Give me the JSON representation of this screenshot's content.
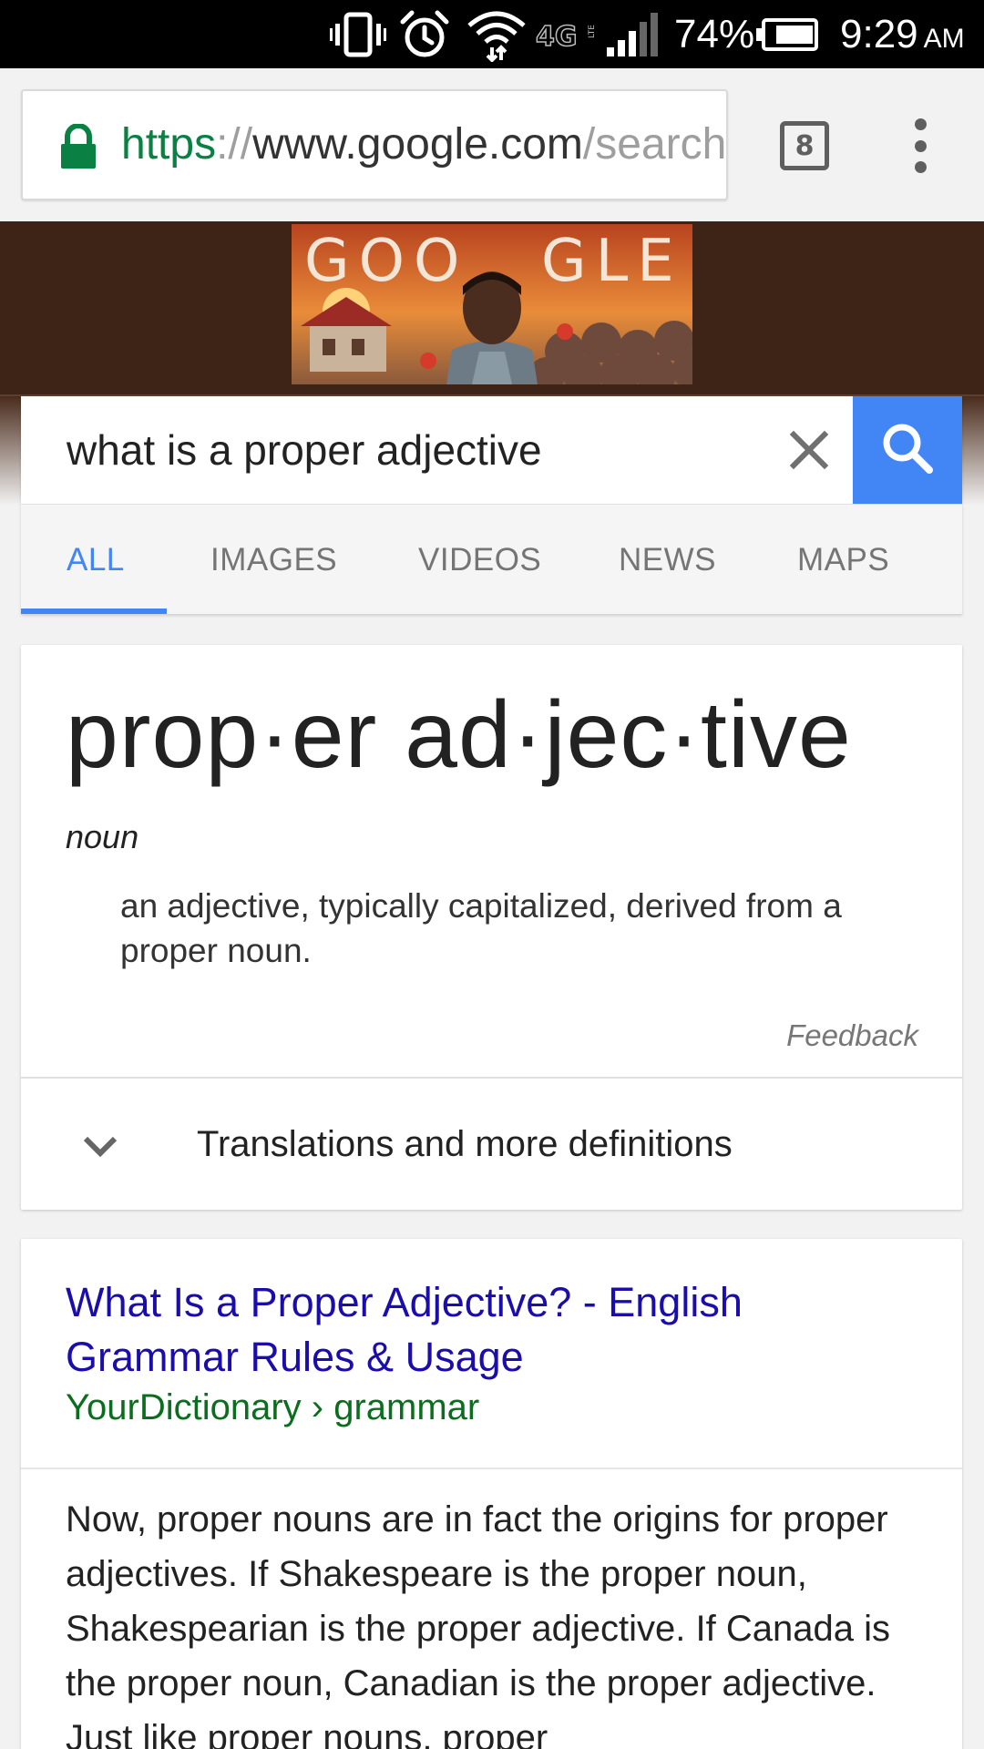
{
  "status_bar": {
    "battery_percent": "74%",
    "time": "9:29",
    "ampm": "AM",
    "network": "4G",
    "network_sub": "LTE",
    "icons": [
      "vibrate-icon",
      "alarm-icon",
      "wifi-icon",
      "lte-icon",
      "signal-icon",
      "battery-icon"
    ]
  },
  "address_bar": {
    "scheme": "https",
    "separator": "://",
    "host": "www.google.com",
    "path": "/search",
    "tab_count": "8"
  },
  "search": {
    "query": "what is a proper adjective"
  },
  "tabs": [
    {
      "label": "ALL",
      "active": true
    },
    {
      "label": "IMAGES",
      "active": false
    },
    {
      "label": "VIDEOS",
      "active": false
    },
    {
      "label": "NEWS",
      "active": false
    },
    {
      "label": "MAPS",
      "active": false
    }
  ],
  "doodle": {
    "text": "GOOGLE"
  },
  "definition": {
    "word": "prop·er ad·jec·tive",
    "part_of_speech": "noun",
    "meaning": "an adjective, typically capitalized, derived from a proper noun.",
    "feedback_label": "Feedback",
    "more_label": "Translations and more definitions"
  },
  "result": {
    "title": "What Is a Proper Adjective? - English Grammar Rules & Usage",
    "breadcrumb": "YourDictionary › grammar",
    "snippet": "Now, proper nouns are in fact the origins for proper adjectives. If Shakespeare is the proper noun, Shakespearian is the proper adjective. If Canada is the proper noun, Canadian is the proper adjective. Just like proper nouns, proper"
  },
  "colors": {
    "accent": "#4285f4",
    "link": "#1a0dab",
    "url_green": "#0b8043",
    "breadcrumb_green": "#0b6e1e",
    "doodle_band": "#3d2417"
  }
}
